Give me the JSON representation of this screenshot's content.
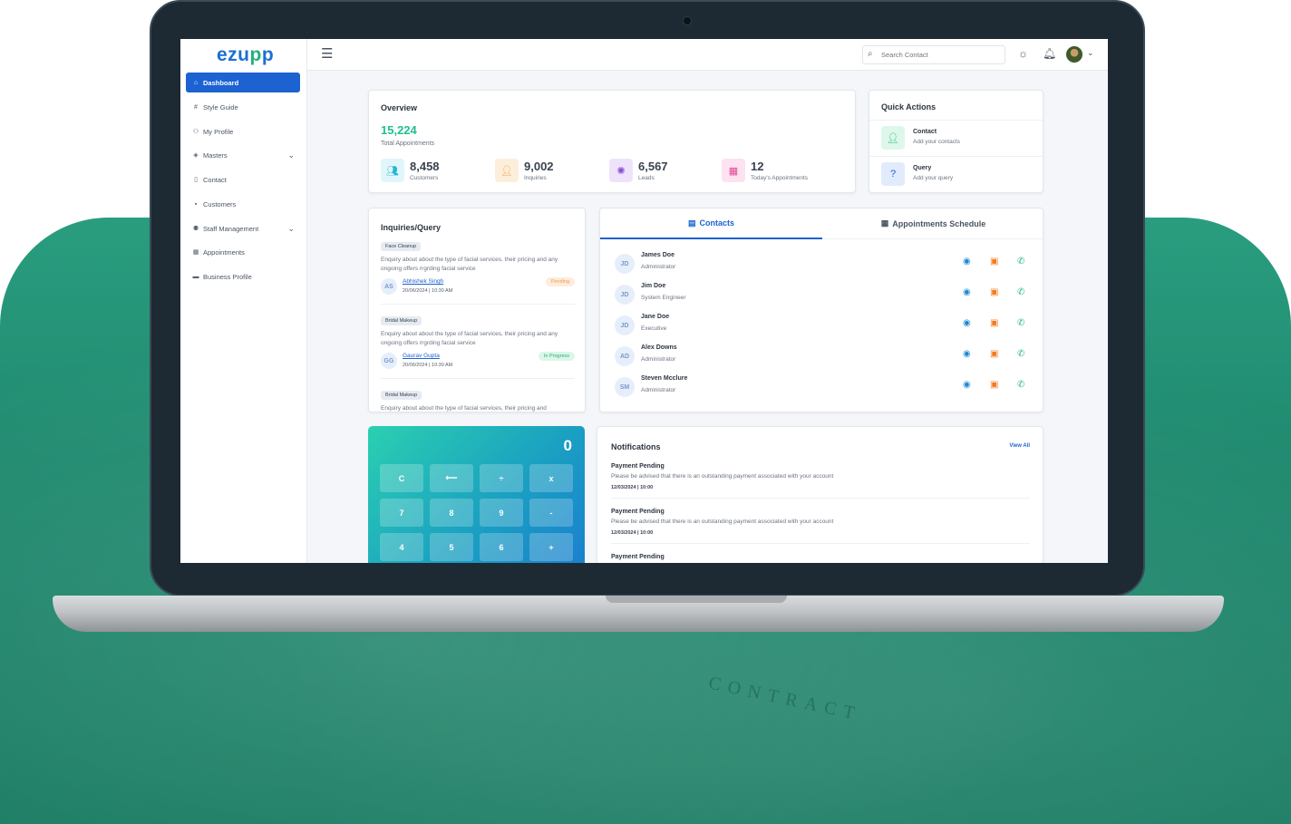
{
  "sidebar": {
    "logo_main": "ezu",
    "logo_arrow": "p",
    "logo_end": "p",
    "items": [
      {
        "label": "Dashboard",
        "icon": "home-icon"
      },
      {
        "label": "Style Guide",
        "icon": "hash-icon"
      },
      {
        "label": "My Profile",
        "icon": "user-icon"
      },
      {
        "label": "Masters",
        "icon": "layers-icon"
      },
      {
        "label": "Contact",
        "icon": "contact-icon"
      },
      {
        "label": "Customers",
        "icon": "customers-icon"
      },
      {
        "label": "Staff Management",
        "icon": "staff-icon"
      },
      {
        "label": "Appointments",
        "icon": "calendar-icon"
      },
      {
        "label": "Business Profile",
        "icon": "briefcase-icon"
      }
    ]
  },
  "topbar": {
    "search_placeholder": "Search Contact"
  },
  "overview": {
    "title": "Overview",
    "total_value": "15,224",
    "total_label": "Total Appointments",
    "stats": [
      {
        "value": "8,458",
        "label": "Customers",
        "color": "#20b8d6"
      },
      {
        "value": "9,002",
        "label": "Inquiries",
        "color": "#f5a34a"
      },
      {
        "value": "6,567",
        "label": "Leads",
        "color": "#8a4fd6"
      },
      {
        "value": "12",
        "label": "Today's Appointments",
        "color": "#e0479a"
      }
    ]
  },
  "quick_actions": {
    "title": "Quick Actions",
    "items": [
      {
        "title": "Contact",
        "subtitle": "Add your contacts"
      },
      {
        "title": "Query",
        "subtitle": "Add your query"
      }
    ]
  },
  "inquiries": {
    "title": "Inquiries/Query",
    "items": [
      {
        "tag": "Face Cleanup",
        "text": "Enquiry about about the type of facial services, their pricing and any ongoing offers rrgrding facial service",
        "initials": "AS",
        "name": "Abhishek Singh",
        "date": "20/06/2024 | 10:30 AM",
        "status": "Pending"
      },
      {
        "tag": "Bridal Makeup",
        "text": "Enquiry about about the type of facial services, their pricing and any ongoing offers rrgrding facial service",
        "initials": "GG",
        "name": "Gaurav Gupta",
        "date": "20/06/2024 | 10:30 AM",
        "status": "In Progress"
      },
      {
        "tag": "Bridal Makeup",
        "text": "Enquiry about about the type of facial services, their pricing and"
      }
    ]
  },
  "contacts": {
    "tabs": [
      "Contacts",
      "Appointments Schedule"
    ],
    "rows": [
      {
        "initials": "JD",
        "name": "James Doe",
        "role": "Administrator"
      },
      {
        "initials": "JD",
        "name": "Jim Doe",
        "role": "System Engineer"
      },
      {
        "initials": "JD",
        "name": "Jane Doe",
        "role": "Executive"
      },
      {
        "initials": "AD",
        "name": "Alex Downs",
        "role": "Administrator"
      },
      {
        "initials": "SM",
        "name": "Steven Mcclure",
        "role": "Administrator"
      }
    ]
  },
  "calculator": {
    "display": "0",
    "keys": [
      "C",
      "⟵",
      "÷",
      "x",
      "7",
      "8",
      "9",
      "-",
      "4",
      "5",
      "6",
      "+"
    ]
  },
  "notifications": {
    "title": "Notifications",
    "view_all": "View All",
    "items": [
      {
        "title": "Payment Pending",
        "message": "Please be advised that there is an outstanding payment associated with your account",
        "date": "12/03/2024 | 10:00"
      },
      {
        "title": "Payment Pending",
        "message": "Please be advised that there is an outstanding payment associated with your account",
        "date": "12/03/2024 | 10:00"
      },
      {
        "title": "Payment Pending"
      }
    ]
  },
  "background": {
    "watermark": "CONTRACT"
  }
}
